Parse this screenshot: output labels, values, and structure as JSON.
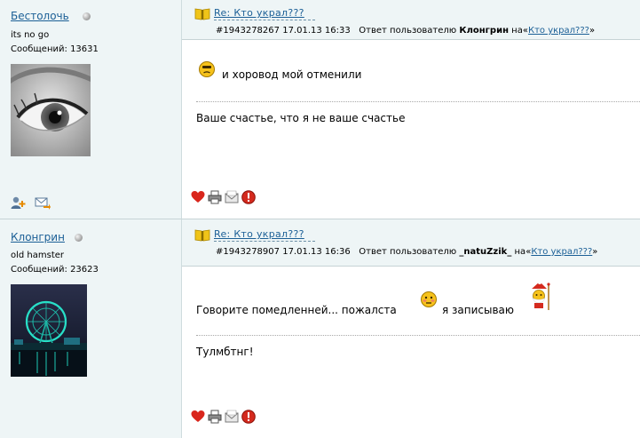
{
  "posts": [
    {
      "author": {
        "name": "Бестолочь",
        "subtitle": "its no go",
        "posts_label": "Сообщений:",
        "posts_count": "13631"
      },
      "header": {
        "title": "Re: Кто украл???",
        "id": "#1943278267",
        "date": "17.01.13 16:33",
        "reply_prefix": "Ответ пользователю",
        "reply_user": "Клонгрин",
        "on_label": "на",
        "reply_link": "Кто украл???"
      },
      "body": {
        "text1": "и хоровод мой отменили",
        "text2": "Ваше счастье, что я не ваше счастье"
      }
    },
    {
      "author": {
        "name": "Клонгрин",
        "subtitle": "old hamster",
        "posts_label": "Сообщений:",
        "posts_count": "23623"
      },
      "header": {
        "title": "Re: Кто украл???",
        "id": "#1943278907",
        "date": "17.01.13 16:36",
        "reply_prefix": "Ответ пользователю",
        "reply_user": "_natuZzik_",
        "on_label": "на",
        "reply_link": "Кто украл???"
      },
      "body": {
        "text1a": "Говорите помедленней... пожалста",
        "text1b": "я записываю",
        "text2": "Тулмбтнг!"
      }
    }
  ],
  "icons": {
    "online_status": "status-dot-icon",
    "add_friend": "add-user-icon",
    "send_message": "envelope-arrow-icon",
    "post_book": "book-icon",
    "like": "heart-icon",
    "print": "printer-icon",
    "email": "envelope-icon",
    "report": "warning-icon"
  },
  "colors": {
    "link": "#1b5f96",
    "panel_bg": "#eef5f6",
    "report_red": "#d42a1e",
    "heart_red": "#d9261c"
  }
}
